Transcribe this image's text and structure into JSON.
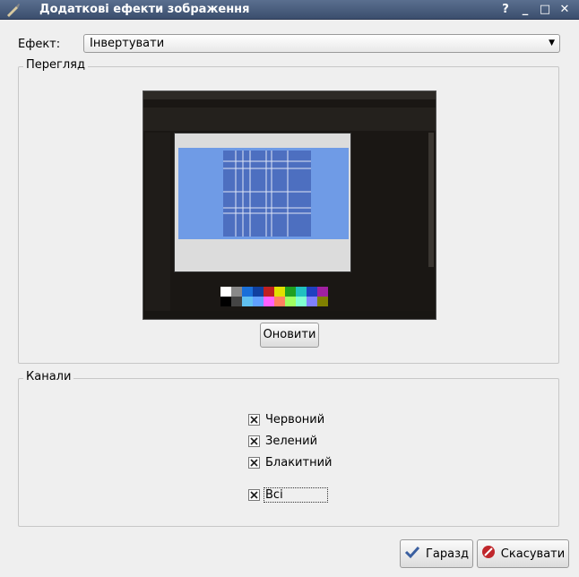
{
  "window": {
    "title": "Додаткові ефекти зображення",
    "help_glyph": "?",
    "minimize_glyph": "_",
    "maximize_glyph": "□",
    "close_glyph": "✕"
  },
  "effect": {
    "label": "Ефект:",
    "selected": "Інвертувати"
  },
  "preview": {
    "group_title": "Перегляд",
    "refresh_label": "Оновити"
  },
  "channels": {
    "group_title": "Канали",
    "items": [
      {
        "label": "Червоний",
        "checked": true
      },
      {
        "label": "Зелений",
        "checked": true
      },
      {
        "label": "Блакитний",
        "checked": true
      }
    ],
    "all": {
      "label": "Всі",
      "checked": true
    }
  },
  "buttons": {
    "ok_label": "Гаразд",
    "cancel_label": "Скасувати"
  },
  "colors": {
    "titlebar": "#3b4e6d",
    "ok_icon": "#3a5fa0",
    "cancel_icon": "#c0262b"
  }
}
